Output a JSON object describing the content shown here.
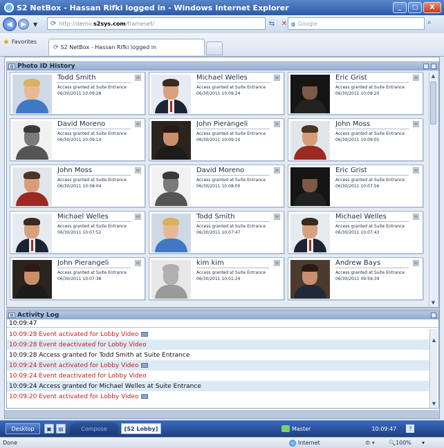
{
  "window": {
    "title": "S2 NetBox - Hassan Rifki logged in    - Windows Internet Explorer",
    "minimize_label": "_",
    "maximize_label": "□",
    "close_label": "X"
  },
  "navigation": {
    "address_prefix": "http://demo.",
    "address_host": "s2sys.com",
    "address_suffix": "/frameset/",
    "search_placeholder": "Google",
    "search_logo": "g",
    "back_label": "◀",
    "forward_label": "▶",
    "dropdown_label": "▼",
    "go_label": "⇆",
    "stop_label": "✕",
    "search_go_label": "⌕"
  },
  "favorites": {
    "label": "Favorites",
    "tab_label": "S2 NetBox - Hassan Rifki logged in"
  },
  "photo_panel": {
    "title": "Photo ID History",
    "cards": [
      {
        "name": "Todd Smith",
        "desc": "Access granted at Suite Entrance",
        "time": "06/30/2011 10:09:28",
        "photo": "blond-blue"
      },
      {
        "name": "Michael Welles",
        "desc": "Access granted at Suite Entrance",
        "time": "06/30/2011 10:09:24",
        "photo": "dark-suit-red"
      },
      {
        "name": "Eric Grist",
        "desc": "Access granted at Suite Entrance",
        "time": "06/30/2011 10:09:20",
        "photo": "dark-bg"
      },
      {
        "name": "David Moreno",
        "desc": "Access granted at Suite Entrance",
        "time": "06/30/2011 10:09:14",
        "photo": "grey-bw"
      },
      {
        "name": "John Pierangeli",
        "desc": "Access granted at Suite Entrance",
        "time": "06/30/2011 10:09:10",
        "photo": "dark-warm"
      },
      {
        "name": "John Moss",
        "desc": "Access granted at Suite Entrance",
        "time": "06/30/2011 10:09:05",
        "photo": "red-shirt"
      },
      {
        "name": "John Moss",
        "desc": "Access granted at Suite Entrance",
        "time": "06/30/2011 10:08:04",
        "photo": "red-shirt"
      },
      {
        "name": "David Moreno",
        "desc": "Access granted at Suite Entrance",
        "time": "06/30/2011 10:08:00",
        "photo": "grey-bw"
      },
      {
        "name": "Eric Grist",
        "desc": "Access granted at Suite Entrance",
        "time": "06/30/2011 10:07:56",
        "photo": "dark-bg"
      },
      {
        "name": "Michael Welles",
        "desc": "Access granted at Suite Entrance",
        "time": "06/30/2011 10:07:52",
        "photo": "dark-suit-red"
      },
      {
        "name": "Todd Smith",
        "desc": "Access granted at Suite Entrance",
        "time": "06/30/2011 10:07:47",
        "photo": "blond-blue"
      },
      {
        "name": "Michael Welles",
        "desc": "Access granted at Suite Entrance",
        "time": "06/30/2011 10:07:43",
        "photo": "dark-suit-red"
      },
      {
        "name": "John Pierangeli",
        "desc": "Access granted at Suite Entrance",
        "time": "06/30/2011 10:07:38",
        "photo": "dark-warm"
      },
      {
        "name": "kim kim",
        "desc": "Access granted at Suite Entrance",
        "time": "06/30/2011 10:01:24",
        "photo": "silhouette"
      },
      {
        "name": "Andrew Bays",
        "desc": "Access granted at Suite Entrance",
        "time": "06/30/2011 09:59:39",
        "photo": "office"
      }
    ]
  },
  "activity_log": {
    "title": "Activity Log",
    "header_time": "10:09:47",
    "rows": [
      {
        "text": "10:09:28 Event activated for Lobby Video",
        "color": "red",
        "camera": true
      },
      {
        "text": "10:09:28 Event deactivated for Lobby Video",
        "color": "red",
        "camera": false
      },
      {
        "text": "10:09:28 Access granted for Todd Smith at Suite Entrance",
        "color": "black",
        "camera": false
      },
      {
        "text": "10:09:24 Event activated for Lobby Video",
        "color": "red",
        "camera": true
      },
      {
        "text": "10:09:24 Event deactivated for Lobby Video",
        "color": "red",
        "camera": false
      },
      {
        "text": "10:09:24 Access granted for Michael Welles at Suite Entrance",
        "color": "black",
        "camera": false
      },
      {
        "text": "10:09:20 Event activated for Lobby Video",
        "color": "red",
        "camera": true
      }
    ]
  },
  "taskbar": {
    "desktop_label": "Desktop",
    "compose_label": "Compose",
    "tab_label": "[S2 Lobby]",
    "master_label": "Master",
    "time": "10:09:47",
    "help_label": "?"
  },
  "statusbar": {
    "status": "Done",
    "zone": "Internet",
    "protected": "⚙ ▾",
    "zoom": "🔍100%",
    "caret": "▾"
  },
  "colors": {
    "log_red": "#c41e1e",
    "titlebar": "#2b59a8",
    "panel_header": "#8fa9cd"
  }
}
